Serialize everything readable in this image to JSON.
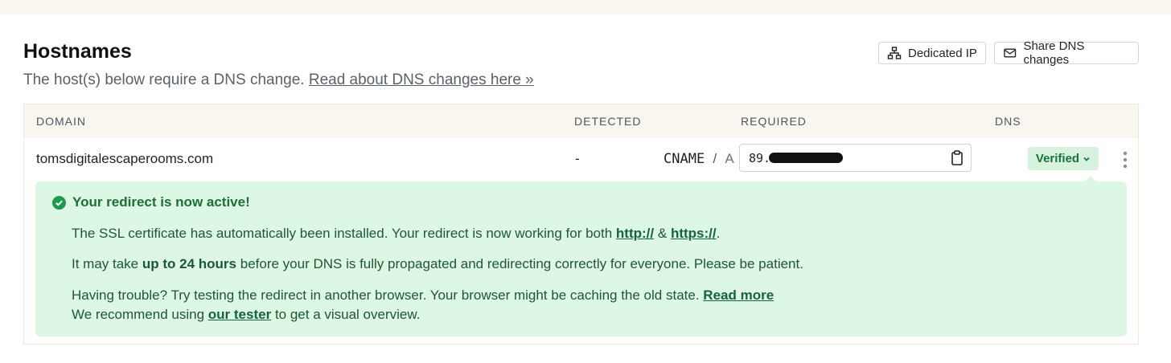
{
  "header": {
    "title": "Hostnames",
    "subtitle_text": "The host(s) below require a DNS change.",
    "subtitle_link": "Read about DNS changes here »",
    "buttons": {
      "dedicated_ip": "Dedicated IP",
      "share_dns": "Share DNS changes"
    }
  },
  "table": {
    "columns": [
      "DOMAIN",
      "DETECTED",
      "REQUIRED",
      "DNS"
    ],
    "row": {
      "domain": "tomsdigitalescaperooms.com",
      "detected": "-",
      "record_type_primary": "CNAME",
      "record_type_sep": "/",
      "record_type_alt": "A",
      "required_value_prefix": "89.",
      "dns_status": "Verified"
    }
  },
  "panel": {
    "heading": "Your redirect is now active!",
    "line1_text": "The SSL certificate has automatically been installed. Your redirect is now working for both",
    "line1_link1": "http://",
    "line1_amp": "&",
    "line1_link2": "https://",
    "line1_end": ".",
    "line2_start": "It may take",
    "line2_bold": "up to 24 hours",
    "line2_end": "before your DNS is fully propagated and redirecting correctly for everyone. Please be patient.",
    "line3_text": "Having trouble? Try testing the redirect in another browser. Your browser might be caching the old state.",
    "line3_link": "Read more",
    "line4_start": "We recommend using",
    "line4_link": "our tester",
    "line4_end": "to get a visual overview."
  },
  "colors": {
    "success_bg": "#dcf7e4",
    "success_text": "#1b6f38",
    "header_band": "#f8f6ee"
  }
}
